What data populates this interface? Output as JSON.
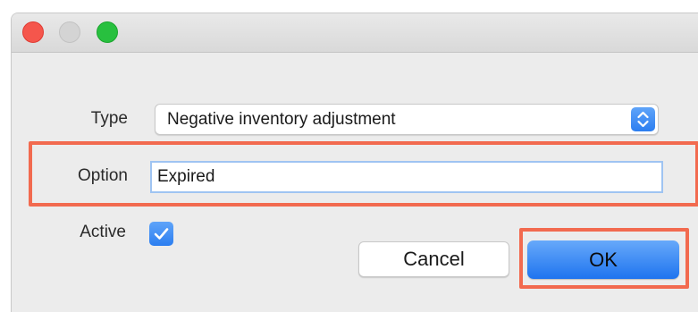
{
  "window": {
    "title": ""
  },
  "form": {
    "type_label": "Type",
    "type_value": "Negative inventory adjustment",
    "option_label": "Option",
    "option_value": "Expired",
    "active_label": "Active",
    "active_checked": true
  },
  "buttons": {
    "cancel_label": "Cancel",
    "ok_label": "OK"
  },
  "colors": {
    "accent": "#2c7ef0",
    "highlight": "#f26a4f",
    "close": "#f5564c",
    "maximize": "#28c03f"
  },
  "icons": {
    "select_arrows": "up-down-chevrons-icon",
    "checkbox": "checkmark-icon"
  }
}
